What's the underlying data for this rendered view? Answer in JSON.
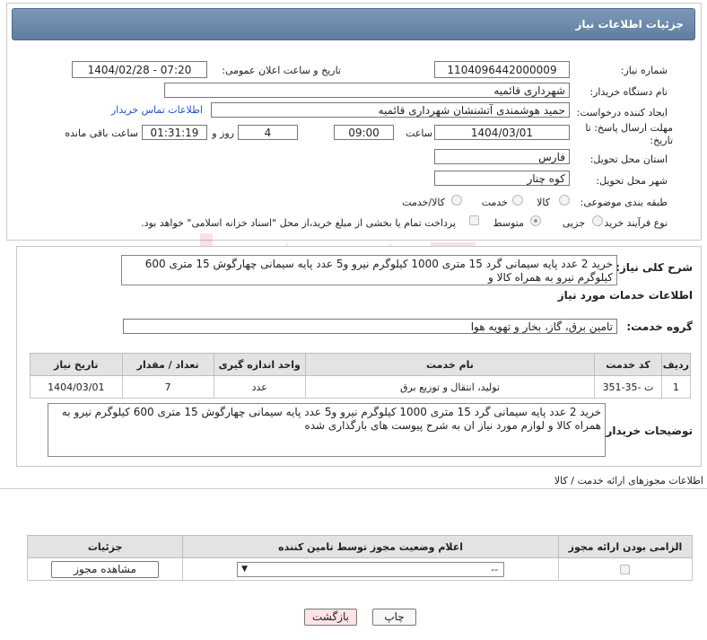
{
  "header": {
    "title": "جزئیات اطلاعات نیاز"
  },
  "form": {
    "need_number_label": "شماره نیاز:",
    "need_number": "1104096442000009",
    "announce_label": "تاریخ و ساعت اعلان عمومی:",
    "announce_value": "1404/02/28 - 07:20",
    "buyer_org_label": "نام دستگاه خریدار:",
    "buyer_org": "شهرداری قائمیه",
    "creator_label": "ایجاد کننده درخواست:",
    "creator": "حمید هوشمندی آتشنشان شهرداری قائمیه",
    "contact_link": "اطلاعات تماس خریدار",
    "deadline_label": "مهلت ارسال پاسخ: تا تاریخ:",
    "deadline_date": "1404/03/01",
    "time_label": "ساعت",
    "deadline_time": "09:00",
    "days_value": "4",
    "days_label": "روز و",
    "remaining_time": "01:31:19",
    "remaining_label": "ساعت باقی مانده",
    "province_label": "استان محل تحویل:",
    "province": "فارس",
    "city_label": "شهر محل تحویل:",
    "city": "کوه چنار",
    "category_label": "طبقه بندی موضوعی:",
    "category_options": [
      "کالا",
      "خدمت",
      "کالا/خدمت"
    ],
    "process_label": "نوع فرآیند خرید :",
    "process_options": [
      "جزیی",
      "متوسط"
    ],
    "payment_note": "پرداخت تمام یا بخشی از مبلغ خرید،از محل \"اسناد خزانه اسلامی\" خواهد بود."
  },
  "summary": {
    "label": "شرح کلی نیاز:",
    "text": "خرید 2 عدد پایه سیمانی گرد 15 متری 1000 کیلوگرم نیرو و5 عدد پایه سیمانی چهارگوش 15 متری 600 کیلوگرم نیرو به همراه کالا و"
  },
  "services": {
    "section_title": "اطلاعات خدمات مورد نیاز",
    "group_label": "گروه خدمت:",
    "group_value": "تامین برق، گاز، بخار و تهویه هوا",
    "columns": [
      "ردیف",
      "کد خدمت",
      "نام خدمت",
      "واحد اندازه گیری",
      "تعداد / مقدار",
      "تاریخ نیاز"
    ],
    "rows": [
      [
        "1",
        "ت -35-351",
        "تولید، انتقال و توزیع برق",
        "عدد",
        "7",
        "1404/03/01"
      ]
    ]
  },
  "buyer_notes": {
    "label": "توضیحات خریدار:",
    "text": "خرید 2 عدد پایه سیمانی گرد 15 متری 1000 کیلوگرم نیرو و5 عدد پایه سیمانی چهارگوش 15 متری 600 کیلوگرم نیرو به همراه کالا و لوازم مورد نیاز ان به شرح پیوست های بارگذاری شده"
  },
  "permits": {
    "section_title": "اطلاعات مجوزهای ارائه خدمت / کالا",
    "columns": [
      "الزامی بودن ارائه مجوز",
      "اعلام وضعیت مجوز توسط تامین کننده",
      "جزئیات"
    ],
    "select_value": "--",
    "view_button": "مشاهده مجوز"
  },
  "footer": {
    "print_button": "چاپ",
    "back_button": "بازگشت"
  },
  "colors": {
    "header_bg": "#6a88a9",
    "link": "#1f55c8",
    "back_button_bg": "#fde3e3"
  }
}
